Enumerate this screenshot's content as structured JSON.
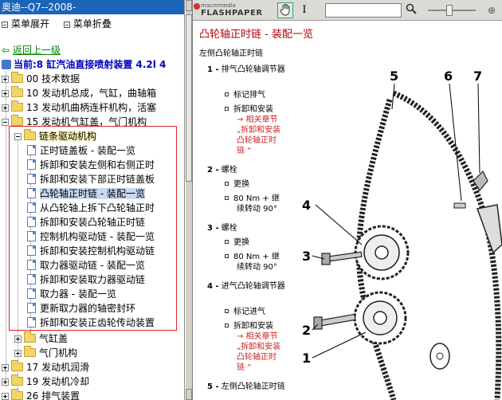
{
  "left_pane": {
    "title": "奥迪--Q7--2008-",
    "menu": {
      "expand": "菜单展开",
      "collapse": "菜单折叠"
    },
    "back_link": "返回上一级",
    "current": "当前:8 缸汽油直接喷射装置  4.2l 4",
    "tree": [
      {
        "label": "00 技术数据",
        "kind": "folder"
      },
      {
        "label": "10 发动机总成，气缸，曲轴箱",
        "kind": "folder"
      },
      {
        "label": "13 发动机曲柄连杆机构，活塞",
        "kind": "folder"
      },
      {
        "label": "15 发动机气缸盖，气门机构",
        "kind": "folder-open"
      },
      {
        "label": "链条驱动机构",
        "kind": "folder-open"
      },
      {
        "label": "正时链盖板 - 装配一览",
        "kind": "doc"
      },
      {
        "label": "拆卸和安装左侧和右侧正时",
        "kind": "doc"
      },
      {
        "label": "拆卸和安装下部正时链盖板",
        "kind": "doc"
      },
      {
        "label": "凸轮轴正时链 - 装配一览",
        "kind": "doc"
      },
      {
        "label": "从凸轮轴上拆下凸轮轴正时",
        "kind": "doc"
      },
      {
        "label": "拆卸和安装凸轮轴正时链",
        "kind": "doc"
      },
      {
        "label": "控制机构驱动链 - 装配一览",
        "kind": "doc"
      },
      {
        "label": "拆卸和安装控制机构驱动链",
        "kind": "doc"
      },
      {
        "label": "取力器驱动链 - 装配一览",
        "kind": "doc"
      },
      {
        "label": "拆卸和安装取力器驱动链",
        "kind": "doc"
      },
      {
        "label": "取力器  - 装配一览",
        "kind": "doc"
      },
      {
        "label": "更新取力器的轴密封环",
        "kind": "doc"
      },
      {
        "label": "拆卸和安装正齿轮传动装置",
        "kind": "doc"
      },
      {
        "label": "气缸盖",
        "kind": "folder"
      },
      {
        "label": "气门机构",
        "kind": "folder"
      },
      {
        "label": "17 发动机润滑",
        "kind": "folder"
      },
      {
        "label": "19 发动机冷却",
        "kind": "folder"
      },
      {
        "label": "26 排气装置",
        "kind": "folder"
      }
    ]
  },
  "viewer": {
    "logo_top": "macromedia",
    "logo_main": "FLASHPAPER",
    "hand_icon": "hand-tool-icon",
    "text_icon": "text-select-icon",
    "search_icon": "magnifier-icon",
    "find_placeholder": ""
  },
  "document": {
    "title": "凸轮轴正时链 - 装配一览",
    "subtitle": "左侧凸轮轴正时链",
    "legend": [
      {
        "num": "1 -",
        "title": "排气凸轮轴调节器",
        "items": [
          {
            "text": "标记排气",
            "red": false
          },
          {
            "text": "拆卸和安装",
            "red": false
          },
          {
            "text": "→ 相关章节",
            "red": true
          },
          {
            "text": "„拆卸和安装",
            "red": true
          },
          {
            "text": "凸轮轴正时",
            "red": true
          },
          {
            "text": "链 “",
            "red": true
          }
        ]
      },
      {
        "num": "2 -",
        "title": "螺栓",
        "items": [
          {
            "text": "更换",
            "red": false
          },
          {
            "text": "80 Nm + 继",
            "red": false
          },
          {
            "text": "续转动  90°",
            "red": false
          }
        ]
      },
      {
        "num": "3 -",
        "title": "螺栓",
        "items": [
          {
            "text": "更换",
            "red": false
          },
          {
            "text": "80 Nm + 继",
            "red": false
          },
          {
            "text": "续转动  90°",
            "red": false
          }
        ]
      },
      {
        "num": "4 -",
        "title": "进气凸轮轴调节器",
        "items": [
          {
            "text": "标记进气",
            "red": false
          },
          {
            "text": "拆卸和安装",
            "red": false
          },
          {
            "text": "→ 相关章节",
            "red": true
          },
          {
            "text": "„拆卸和安装",
            "red": true
          },
          {
            "text": "凸轮轴正时",
            "red": true
          },
          {
            "text": "链 “",
            "red": true
          }
        ]
      },
      {
        "num": "5 -",
        "title": "左侧凸轮轴正时链",
        "items": []
      }
    ],
    "callouts": [
      "1",
      "2",
      "3",
      "4",
      "5",
      "6",
      "7"
    ]
  }
}
